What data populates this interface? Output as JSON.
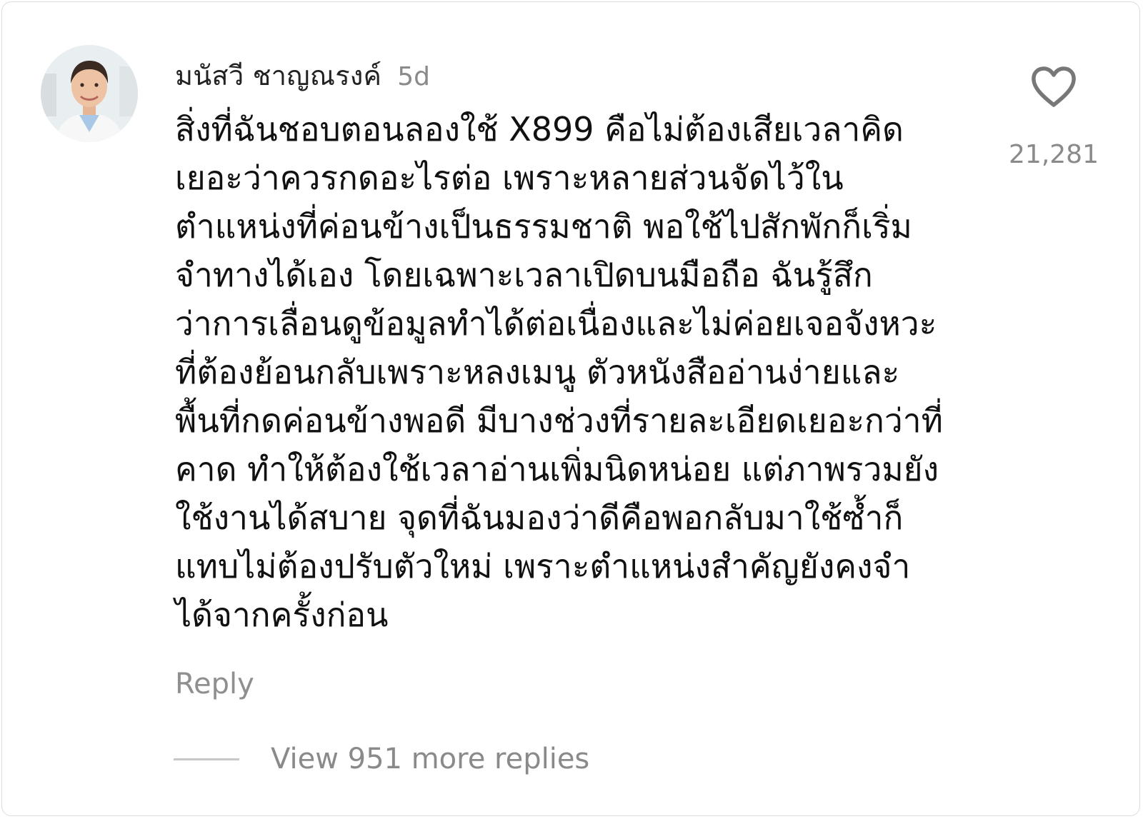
{
  "comment": {
    "author": "มนัสวี ชาญณรงค์",
    "timestamp": "5d",
    "text": "สิ่งที่ฉันชอบตอนลองใช้ X899 คือไม่ต้องเสียเวลาคิดเยอะว่าควรกดอะไรต่อ เพราะหลายส่วนจัดไว้ในตำแหน่งที่ค่อนข้างเป็นธรรมชาติ พอใช้ไปสักพักก็เริ่มจำทางได้เอง โดยเฉพาะเวลาเปิดบนมือถือ ฉันรู้สึกว่าการเลื่อนดูข้อมูลทำได้ต่อเนื่องและไม่ค่อยเจอจังหวะที่ต้องย้อนกลับเพราะหลงเมนู ตัวหนังสืออ่านง่ายและพื้นที่กดค่อนข้างพอดี มีบางช่วงที่รายละเอียดเยอะกว่าที่คาด ทำให้ต้องใช้เวลาอ่านเพิ่มนิดหน่อย แต่ภาพรวมยังใช้งานได้สบาย จุดที่ฉันมองว่าดีคือพอกลับมาใช้ซ้ำก็แทบไม่ต้องปรับตัวใหม่ เพราะตำแหน่งสำคัญยังคงจำได้จากครั้งก่อน",
    "reply_label": "Reply",
    "view_replies_label": "View 951 more replies",
    "like_count": "21,281",
    "like_icon": "heart-outline-icon"
  },
  "colors": {
    "text_primary": "#111111",
    "text_secondary": "#8a8a8a",
    "divider": "#c7c7c7"
  }
}
